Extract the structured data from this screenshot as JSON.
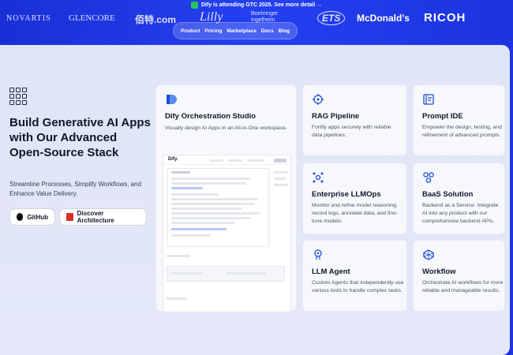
{
  "announcement": {
    "text": "Dify is attending GTC 2025. See more detail →"
  },
  "logos": [
    "NOVARTIS",
    "GLENCORE",
    "佰特.com",
    "Lilly",
    "Boehringer Ingelheim",
    "ETS",
    "McDonald's",
    "RICOH"
  ],
  "nav": {
    "items": [
      "Product",
      "Pricing",
      "Marketplace",
      "Docs",
      "Blog"
    ]
  },
  "hero": {
    "headline": "Build Generative AI Apps with Our Advanced Open-Source Stack",
    "subtext": "Streamline Processes, Simplify Workflows, and Enhance Value Delivery.",
    "github_label": "GitHub",
    "architecture_label": "Discover Architecture"
  },
  "studio": {
    "title": "Dify Orchestration Studio",
    "desc": "Visually design AI Apps in an All-in-One workspace.",
    "mock_brand": "Dify."
  },
  "features": [
    {
      "title": "RAG Pipeline",
      "desc": "Fortify apps securely with reliable data pipelines.",
      "icon": "rag-icon"
    },
    {
      "title": "Prompt IDE",
      "desc": "Empower the design, testing, and refinement of advanced prompts.",
      "icon": "prompt-ide-icon"
    },
    {
      "title": "Enterprise LLMOps",
      "desc": "Monitor and refine model reasoning, record logs, annotate data, and fine-tune models.",
      "icon": "llmops-icon"
    },
    {
      "title": "BaaS Solution",
      "desc": "Backend as a Service: Integrate AI into any product with our comprehensive backend APIs.",
      "icon": "baas-icon"
    },
    {
      "title": "LLM Agent",
      "desc": "Custom Agents that independently use various tools to handle complex tasks.",
      "icon": "agent-icon"
    },
    {
      "title": "Workflow",
      "desc": "Orchestrate AI workflows for more reliable and manageable results.",
      "icon": "workflow-icon"
    }
  ],
  "colors": {
    "brand_blue": "#1f35e0",
    "panel": "#e0e5f7",
    "accent": "#1c4ed8"
  }
}
